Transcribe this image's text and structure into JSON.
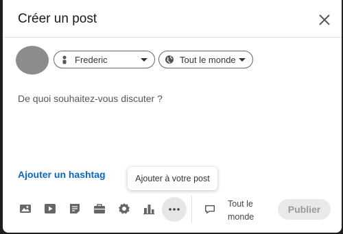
{
  "dialog": {
    "title": "Créer un post",
    "close_icon": "close-icon"
  },
  "author": {
    "name": "Frederic",
    "icon": "person-icon"
  },
  "audience": {
    "label": "Tout le monde",
    "icon": "globe-icon"
  },
  "editor": {
    "placeholder": "De quoi souhaitez-vous discuter ?"
  },
  "hashtag_link": "Ajouter un hashtag",
  "tooltip": "Ajouter à votre post",
  "toolbar": {
    "tools": [
      "image-icon",
      "video-icon",
      "document-icon",
      "briefcase-icon",
      "badge-icon",
      "bar-chart-icon",
      "more-icon"
    ],
    "comment_setting_icon": "comment-icon",
    "comment_setting_label": "Tout le monde",
    "publish_label": "Publier"
  },
  "colors": {
    "link": "#0a66c2",
    "publish_disabled_bg": "#e9e9e9",
    "publish_disabled_text": "#9a9a9a"
  }
}
